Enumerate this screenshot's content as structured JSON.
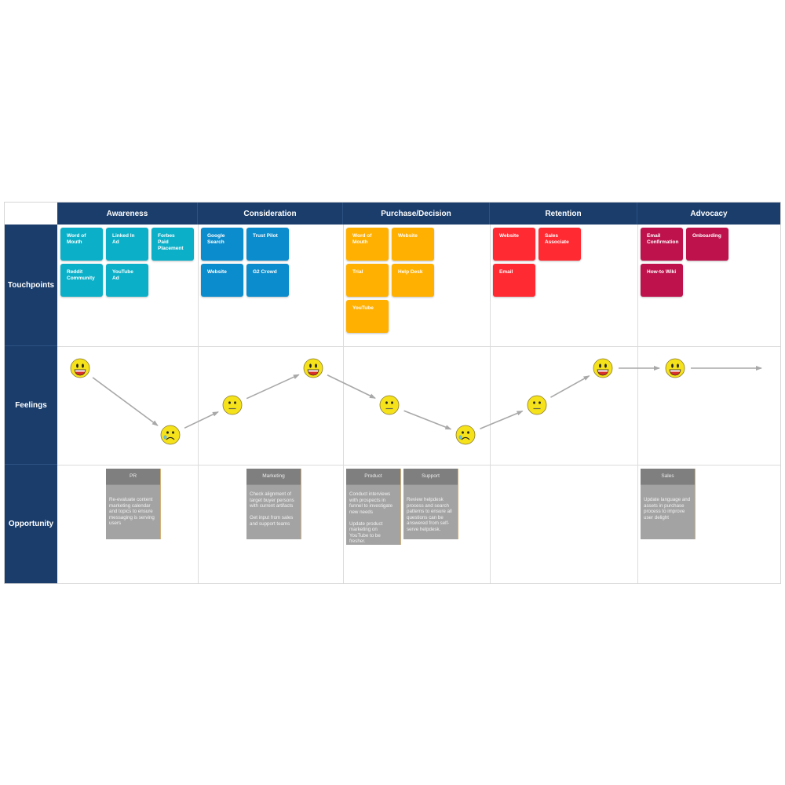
{
  "stages": [
    "Awareness",
    "Consideration",
    "Purchase/Decision",
    "Retention",
    "Advocacy"
  ],
  "rows": [
    "Touchpoints",
    "Feelings",
    "Opportunity"
  ],
  "colors": {
    "header": "#1a3d6b",
    "awareness": "#0bb0c8",
    "consideration": "#0b8ccc",
    "purchase": "#ffb000",
    "retention": "#ff2a32",
    "advocacy": "#be124c",
    "opportunity_header": "#7f7f7f",
    "opportunity_body": "#a3a3a3",
    "arrow": "#a8a8a8"
  },
  "touchpoints": [
    [
      "Word of\nMouth",
      "Linked In\nAd",
      "Forbes\nPaid\nPlacement",
      "Reddit\nCommunity",
      "YouTube\nAd"
    ],
    [
      "Google\nSearch",
      "Trust Pilot",
      "Website",
      "G2 Crowd"
    ],
    [
      "Word of\nMouth",
      "Website",
      "Trial",
      "Help Desk",
      "YouTube"
    ],
    [
      "Website",
      "Sales\nAssociate",
      "Email"
    ],
    [
      "Email\nConfirmation",
      "Onboarding",
      "How-to Wiki"
    ]
  ],
  "feelings": [
    {
      "stage": 0,
      "mood": "happy"
    },
    {
      "stage": 0,
      "mood": "sad"
    },
    {
      "stage": 1,
      "mood": "neutral"
    },
    {
      "stage": 1,
      "mood": "happy"
    },
    {
      "stage": 2,
      "mood": "neutral"
    },
    {
      "stage": 2,
      "mood": "sad"
    },
    {
      "stage": 3,
      "mood": "neutral"
    },
    {
      "stage": 3,
      "mood": "happy"
    },
    {
      "stage": 4,
      "mood": "happy"
    }
  ],
  "opportunities": [
    {
      "stage": 0,
      "title": "PR",
      "body": "Re-evaluate content marketing calendar and topics to ensure messaging is serving users"
    },
    {
      "stage": 1,
      "title": "Marketing",
      "body": "Check alignment of target buyer persons with current artifacts\n\nGet input from sales and support teams"
    },
    {
      "stage": 2,
      "title": "Product",
      "body": "Conduct interviews with prospects in funnel to investigate new needs\n\nUpdate product marketing on YouTube to be fresher."
    },
    {
      "stage": 2,
      "title": "Support",
      "body": "Review helpdesk process and search patterns to ensure all questions can be answered from self-serve helpdesk."
    },
    {
      "stage": 4,
      "title": "Sales",
      "body": "Update language and assets in purchase process to improve user delight"
    }
  ]
}
